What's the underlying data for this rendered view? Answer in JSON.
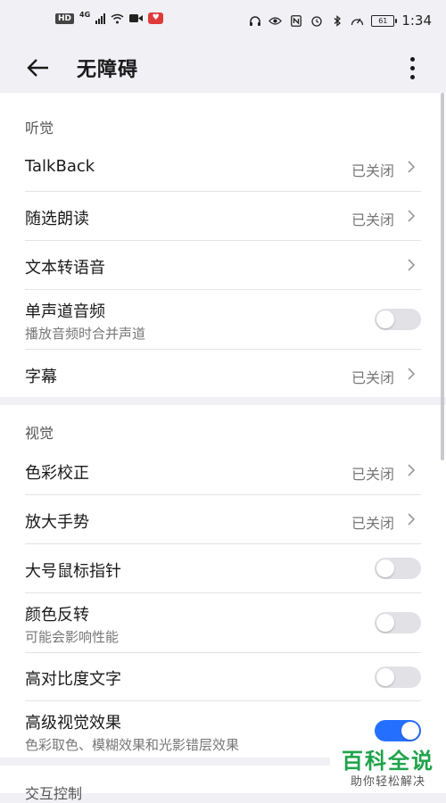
{
  "status_bar": {
    "hd": "HD",
    "network": "4G",
    "battery": "61",
    "time": "1:34"
  },
  "header": {
    "title": "无障碍"
  },
  "sections": {
    "hearing": {
      "title": "听觉",
      "items": [
        {
          "label": "TalkBack",
          "status": "已关闭"
        },
        {
          "label": "随选朗读",
          "status": "已关闭"
        },
        {
          "label": "文本转语音"
        },
        {
          "label": "单声道音频",
          "subtitle": "播放音频时合并声道",
          "toggle": false
        },
        {
          "label": "字幕",
          "status": "已关闭"
        }
      ]
    },
    "vision": {
      "title": "视觉",
      "items": [
        {
          "label": "色彩校正",
          "status": "已关闭"
        },
        {
          "label": "放大手势",
          "status": "已关闭"
        },
        {
          "label": "大号鼠标指针",
          "toggle": false
        },
        {
          "label": "颜色反转",
          "subtitle": "可能会影响性能",
          "toggle": false
        },
        {
          "label": "高对比度文字",
          "toggle": false
        },
        {
          "label": "高级视觉效果",
          "subtitle": "色彩取色、模糊效果和光影错层效果",
          "toggle": true
        }
      ]
    },
    "interaction": {
      "title": "交互控制"
    }
  },
  "watermark": {
    "title": "百科全说",
    "subtitle": "助你轻松解决"
  },
  "colors": {
    "accent": "#256fff",
    "background": "#f1f1f5",
    "card": "#ffffff",
    "watermark_green": "#1fa34a"
  }
}
